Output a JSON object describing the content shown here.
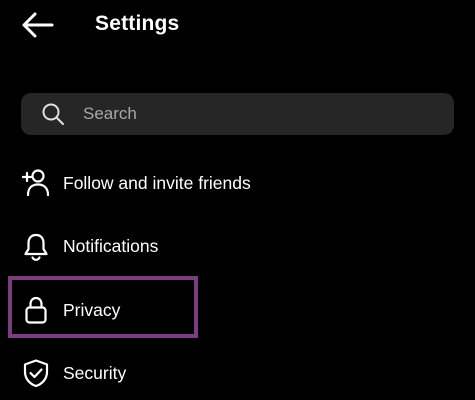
{
  "header": {
    "title": "Settings",
    "back_icon": "arrow-left-icon"
  },
  "search": {
    "placeholder": "Search",
    "value": "",
    "icon": "search-icon"
  },
  "menu": {
    "items": [
      {
        "label": "Follow and invite friends",
        "icon": "add-person-icon"
      },
      {
        "label": "Notifications",
        "icon": "bell-icon"
      },
      {
        "label": "Privacy",
        "icon": "lock-icon"
      },
      {
        "label": "Security",
        "icon": "shield-check-icon"
      }
    ]
  },
  "highlight": {
    "target": "Privacy",
    "color": "#7a3e80"
  },
  "colors": {
    "background": "#000000",
    "search_background": "#262626",
    "text": "#ffffff",
    "placeholder": "#a8a8a8"
  }
}
